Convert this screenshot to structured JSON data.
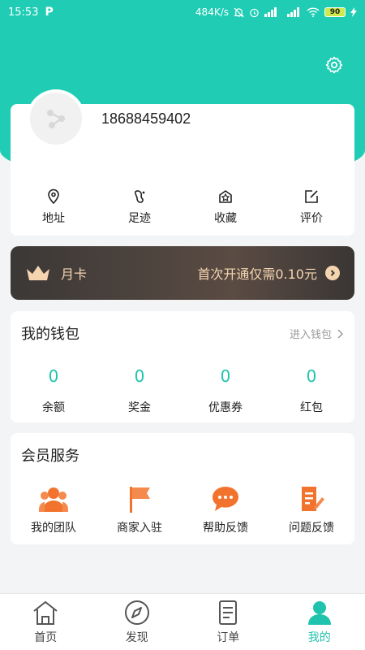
{
  "status_bar": {
    "time": "15:53",
    "app_badge": "P",
    "net_speed": "484K/s",
    "battery": "90"
  },
  "profile": {
    "phone": "18688459402"
  },
  "quick_actions": [
    {
      "label": "地址",
      "icon": "location-pin-icon"
    },
    {
      "label": "足迹",
      "icon": "footprint-icon"
    },
    {
      "label": "收藏",
      "icon": "favorite-box-icon"
    },
    {
      "label": "评价",
      "icon": "edit-review-icon"
    }
  ],
  "vip": {
    "title": "月卡",
    "promo": "首次开通仅需0.10元",
    "accent": "#f5d5b0"
  },
  "wallet": {
    "title": "我的钱包",
    "enter_label": "进入钱包",
    "items": [
      {
        "value": "0",
        "label": "余额"
      },
      {
        "value": "0",
        "label": "奖金"
      },
      {
        "value": "0",
        "label": "优惠券"
      },
      {
        "value": "0",
        "label": "红包"
      }
    ]
  },
  "member": {
    "title": "会员服务",
    "items": [
      {
        "label": "我的团队",
        "icon": "team-icon"
      },
      {
        "label": "商家入驻",
        "icon": "flag-icon"
      },
      {
        "label": "帮助反馈",
        "icon": "chat-bubble-icon"
      },
      {
        "label": "问题反馈",
        "icon": "document-edit-icon"
      }
    ],
    "icon_color": "#f2732e"
  },
  "bottom_nav": [
    {
      "label": "首页",
      "icon": "home-icon"
    },
    {
      "label": "发现",
      "icon": "compass-icon"
    },
    {
      "label": "订单",
      "icon": "order-list-icon"
    },
    {
      "label": "我的",
      "icon": "user-icon",
      "active": true
    }
  ],
  "colors": {
    "brand": "#20cdb4",
    "wallet_value": "#20c3ad"
  }
}
